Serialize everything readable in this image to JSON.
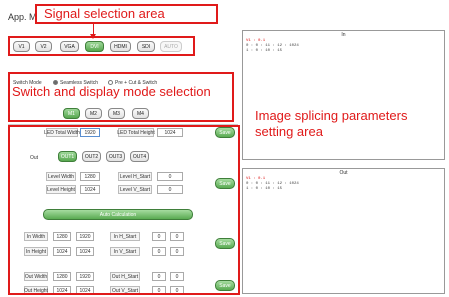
{
  "window": {
    "title": "App. Mode(4 Picture)"
  },
  "annotations": {
    "signal_area": "Signal selection area",
    "switch_area": "Switch and display mode selection",
    "image_splicing": "Image splicing parameters setting area",
    "color": "#e01a1a"
  },
  "signals": [
    "V1",
    "V2",
    "VGA",
    "DVI",
    "HDMI",
    "SDI",
    "AUTO"
  ],
  "switch_mode": {
    "label": "Switch Mode",
    "option1": "Seamless Switch",
    "option2": "Pre + Cut & Switch"
  },
  "display_modes": [
    "M1",
    "M2",
    "M3",
    "M4"
  ],
  "led": {
    "width_label": "LED Total Width",
    "width_value": "1920",
    "height_label": "LED Total Height",
    "height_value": "1024",
    "save": "Save"
  },
  "out": {
    "label": "Out",
    "buttons": [
      "OUT1",
      "OUT2",
      "OUT3",
      "OUT4"
    ]
  },
  "level": {
    "w_label": "Level Width",
    "w_value": "1280",
    "ws_label": "Level H_Start",
    "ws_value": "0",
    "h_label": "Level Height",
    "h_value": "1024",
    "hs_label": "Level V_Start",
    "hs_value": "0",
    "save": "Save"
  },
  "auto_calc": "Auto Calculation",
  "in": {
    "w_label": "In Width",
    "w_value": "1280",
    "w_value2": "1920",
    "ws_label": "In H_Start",
    "ws_value": "0",
    "ws_value2": "0",
    "h_label": "In Height",
    "h_value": "1024",
    "h_value2": "1024",
    "hs_label": "In V_Start",
    "hs_value": "0",
    "hs_value2": "0",
    "save": "Save"
  },
  "outparams": {
    "w_label": "Out Width",
    "w_value": "1280",
    "w_value2": "1920",
    "ws_label": "Out H_Start",
    "ws_value": "0",
    "ws_value2": "0",
    "h_label": "Out Height",
    "h_value": "1024",
    "h_value2": "1024",
    "hs_label": "Out V_Start",
    "hs_value": "0",
    "hs_value2": "0",
    "save": "Save"
  },
  "panel_in": {
    "title": "In",
    "lines": [
      "V1 : 0.1",
      "0 : 0 : 11 : 12 : 1024",
      "1 : 0 : 10 : 15"
    ]
  },
  "panel_out": {
    "title": "Out",
    "lines": [
      "V1 : 0.1",
      "0 : 0 : 11 : 12 : 1024",
      "1 : 0 : 10 : 15"
    ]
  }
}
